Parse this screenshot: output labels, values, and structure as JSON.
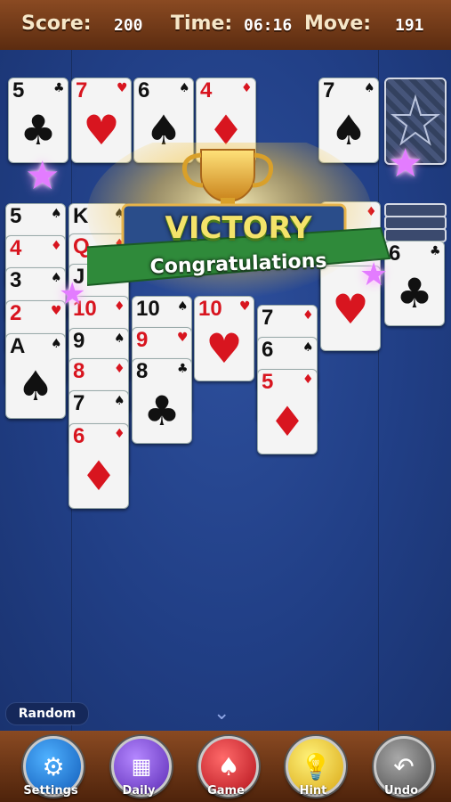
{
  "hud": {
    "score_label": "Score:",
    "score_value": "200",
    "time_label": "Time:",
    "time_value": "06:16",
    "move_label": "Move:",
    "move_value": "191"
  },
  "colors": {
    "felt": "#213f86",
    "wood": "#6f3818",
    "banner_green": "#2f8a3a",
    "victory_gold": "#f4c53a"
  },
  "foundations": [
    {
      "rank": "5",
      "suit": "♣"
    },
    {
      "rank": "7",
      "suit": "♥"
    },
    {
      "rank": "6",
      "suit": "♠"
    },
    {
      "rank": "4",
      "suit": "♦"
    }
  ],
  "waste": {
    "rank": "7",
    "suit": "♠"
  },
  "stock": {
    "icon": "card-back-icon"
  },
  "tableau": {
    "col1": [
      {
        "rank": "5",
        "suit": "♠"
      },
      {
        "rank": "4",
        "suit": "♦"
      },
      {
        "rank": "3",
        "suit": "♠"
      },
      {
        "rank": "2",
        "suit": "♥"
      },
      {
        "rank": "A",
        "suit": "♠"
      }
    ],
    "col2": [
      {
        "rank": "K",
        "suit": "♠"
      },
      {
        "rank": "Q",
        "suit": "♦"
      },
      {
        "rank": "J",
        "suit": "♣"
      },
      {
        "rank": "10",
        "suit": "♦"
      },
      {
        "rank": "9",
        "suit": "♠"
      },
      {
        "rank": "8",
        "suit": "♦"
      },
      {
        "rank": "7",
        "suit": "♠"
      },
      {
        "rank": "6",
        "suit": "♦"
      }
    ],
    "col3": [
      {
        "rank": "10",
        "suit": "♠"
      },
      {
        "rank": "9",
        "suit": "♥"
      },
      {
        "rank": "8",
        "suit": "♣"
      }
    ],
    "col4": [
      {
        "rank": "10",
        "suit": "♥"
      }
    ],
    "col5": [
      {
        "rank": "7",
        "suit": "♦"
      },
      {
        "rank": "6",
        "suit": "♠"
      },
      {
        "rank": "5",
        "suit": "♦"
      }
    ],
    "col6": [
      {
        "rank": "",
        "suit": "♦"
      },
      {
        "rank": "",
        "suit": "♠"
      },
      {
        "rank": "",
        "suit": "♥"
      }
    ],
    "col7": [
      {
        "rank": "6",
        "suit": "♣"
      }
    ]
  },
  "victory": {
    "title": "VICTORY",
    "subtitle": "Congratulations"
  },
  "mode": {
    "label": "Random"
  },
  "toolbar": {
    "settings": "Settings",
    "daily": "Daily",
    "game": "Game",
    "hint": "Hint",
    "undo": "Undo"
  }
}
